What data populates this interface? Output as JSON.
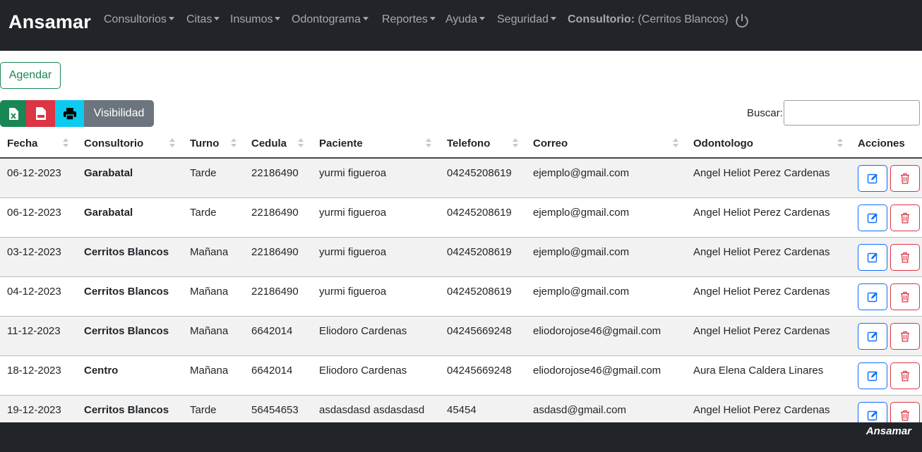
{
  "navbar": {
    "brand": "Ansamar",
    "items": [
      {
        "label": "Consultorios"
      },
      {
        "label": "Citas"
      },
      {
        "label": "Insumos"
      },
      {
        "label": "Odontograma"
      },
      {
        "label": "Reportes"
      },
      {
        "label": "Ayuda"
      },
      {
        "label": "Seguridad"
      }
    ],
    "consultorio_label": "Consultorio:",
    "consultorio_value": "(Cerritos Blancos)",
    "power_icon": "power-icon"
  },
  "actions": {
    "agendar_label": "Agendar",
    "excel_icon": "excel-file-icon",
    "pdf_icon": "pdf-file-icon",
    "print_icon": "printer-icon",
    "visibility_label": "Visibilidad"
  },
  "search": {
    "label": "Buscar:",
    "value": ""
  },
  "table": {
    "headers": [
      "Fecha",
      "Consultorio",
      "Turno",
      "Cedula",
      "Paciente",
      "Telefono",
      "Correo",
      "Odontologo",
      "Acciones"
    ],
    "rows": [
      {
        "fecha": "06-12-2023",
        "consultorio": "Garabatal",
        "turno": "Tarde",
        "cedula": "22186490",
        "paciente": "yurmi figueroa",
        "telefono": "04245208619",
        "correo": "ejemplo@gmail.com",
        "odontologo": "Angel Heliot Perez Cardenas"
      },
      {
        "fecha": "06-12-2023",
        "consultorio": "Garabatal",
        "turno": "Tarde",
        "cedula": "22186490",
        "paciente": "yurmi figueroa",
        "telefono": "04245208619",
        "correo": "ejemplo@gmail.com",
        "odontologo": "Angel Heliot Perez Cardenas"
      },
      {
        "fecha": "03-12-2023",
        "consultorio": "Cerritos Blancos",
        "turno": "Mañana",
        "cedula": "22186490",
        "paciente": "yurmi figueroa",
        "telefono": "04245208619",
        "correo": "ejemplo@gmail.com",
        "odontologo": "Angel Heliot Perez Cardenas"
      },
      {
        "fecha": "04-12-2023",
        "consultorio": "Cerritos Blancos",
        "turno": "Mañana",
        "cedula": "22186490",
        "paciente": "yurmi figueroa",
        "telefono": "04245208619",
        "correo": "ejemplo@gmail.com",
        "odontologo": "Angel Heliot Perez Cardenas"
      },
      {
        "fecha": "11-12-2023",
        "consultorio": "Cerritos Blancos",
        "turno": "Mañana",
        "cedula": "6642014",
        "paciente": "Eliodoro Cardenas",
        "telefono": "04245669248",
        "correo": "eliodorojose46@gmail.com",
        "odontologo": "Angel Heliot Perez Cardenas"
      },
      {
        "fecha": "18-12-2023",
        "consultorio": "Centro",
        "turno": "Mañana",
        "cedula": "6642014",
        "paciente": "Eliodoro Cardenas",
        "telefono": "04245669248",
        "correo": "eliodorojose46@gmail.com",
        "odontologo": "Aura Elena Caldera Linares"
      },
      {
        "fecha": "19-12-2023",
        "consultorio": "Cerritos Blancos",
        "turno": "Tarde",
        "cedula": "56454653",
        "paciente": "asdasdasd asdasdasd",
        "telefono": "45454",
        "correo": "asdasd@gmail.com",
        "odontologo": "Angel Heliot Perez Cardenas"
      }
    ],
    "edit_icon": "edit-icon",
    "delete_icon": "trash-icon"
  },
  "footer": {
    "brand": "Ansamar"
  },
  "colors": {
    "navbar_bg": "#212529",
    "success": "#198754",
    "danger": "#dc3545",
    "info": "#0dcaf0",
    "secondary": "#6c757d",
    "primary": "#0d6efd"
  }
}
